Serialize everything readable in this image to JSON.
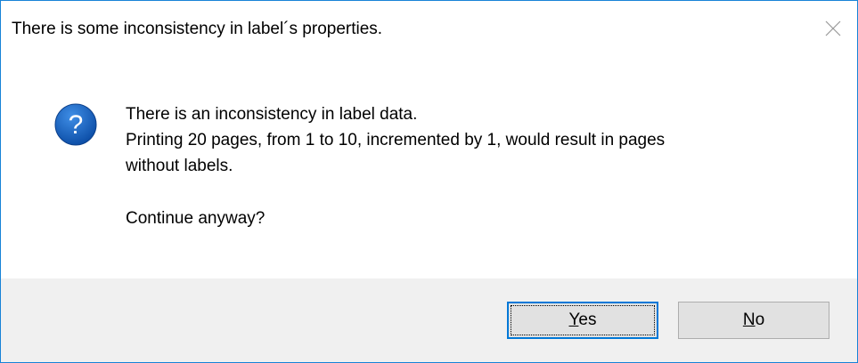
{
  "window": {
    "title": "There is some inconsistency in label´s properties."
  },
  "icon": {
    "name": "question-icon",
    "color": "#1565c0"
  },
  "message": {
    "line1": "There is an inconsistency in label data.",
    "line2": "Printing 20 pages, from 1 to 10, incremented by 1, would result in pages",
    "line3": "without labels.",
    "prompt": "Continue anyway?"
  },
  "buttons": {
    "yes": {
      "accel": "Y",
      "rest": "es"
    },
    "no": {
      "accel": "N",
      "rest": "o"
    }
  },
  "colors": {
    "accent": "#0078d7",
    "footer_bg": "#f0f0f0",
    "button_bg": "#e1e1e1"
  }
}
